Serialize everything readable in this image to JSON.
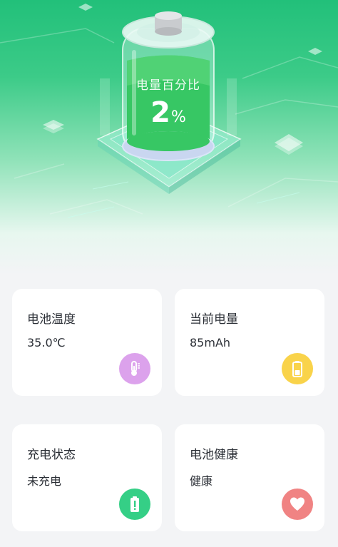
{
  "battery": {
    "title": "电量百分比",
    "percent_number": "2",
    "percent_sign": "%",
    "level_fraction": 0.02
  },
  "cards": [
    {
      "label": "电池温度",
      "value": "35.0℃",
      "icon": "thermometer-icon",
      "icon_color": "#dca2ec"
    },
    {
      "label": "当前电量",
      "value": "85mAh",
      "icon": "battery-icon",
      "icon_color": "#f9d34a"
    },
    {
      "label": "充电状态",
      "value": "未充电",
      "icon": "battery-alert-icon",
      "icon_color": "#35cf86"
    },
    {
      "label": "电池健康",
      "value": "健康",
      "icon": "heart-icon",
      "icon_color": "#f08383"
    }
  ],
  "colors": {
    "hero_green": "#22c07a",
    "card_bg": "#ffffff",
    "page_bg": "#f3f4f6"
  }
}
